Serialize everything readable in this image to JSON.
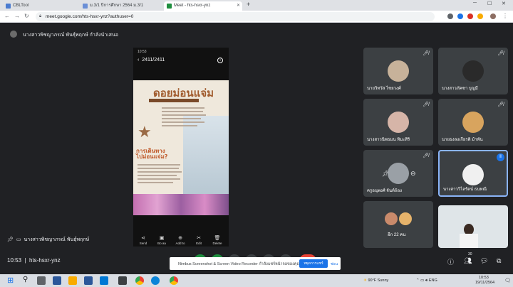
{
  "browser": {
    "tabs": [
      {
        "label": "CBLTool",
        "color": "#4a7bd0"
      },
      {
        "label": "ม.3/1 ปีการศึกษา 2564 ม.3/1",
        "color": "#6b8fd6"
      },
      {
        "label": "Meet - hts-hsxr-ynz",
        "color": "#1e8e3e",
        "close": "✕"
      }
    ],
    "new_tab": "+",
    "window_controls": {
      "minimize": "─",
      "maximize": "☐",
      "close": "✕"
    },
    "url": "meet.google.com/hts-hsxr-ynz?authuser=0"
  },
  "presenter": {
    "banner": "นางสาวพิชญาภรณ์ พันธุ์พฤกษ์ กำลังนำเสนอ",
    "bottom_label": "นางสาวพิชญาภรณ์ พันธุ์พฤกษ์"
  },
  "shared_screen": {
    "status_time": "10:53",
    "header": "2411/2411",
    "poster_title": "ดอยม่อนแจ่ม",
    "poster_subtitle_1": "การเดินทาง",
    "poster_subtitle_2": "ไปม่อนแจ่ม?",
    "actions": [
      "Send",
      "Bo aa",
      "Add to",
      "Edit",
      "Delete"
    ]
  },
  "participants": [
    {
      "name": "นายวิทวัส ไชยวงศ์",
      "muted": true,
      "avatar_color": "#c7b29a"
    },
    {
      "name": "นางสาวภัคชา บุญมี",
      "muted": true,
      "avatar_color": "#2a2a2a"
    },
    {
      "name": "นางสาวนิพธมน หิมะสิริ",
      "muted": true,
      "avatar_color": "#d6b5a8"
    },
    {
      "name": "นายธงลงเกียรติ ม้าพัน",
      "muted": true,
      "avatar_color": "#d8a45e"
    },
    {
      "name": "ครูอนุพงศ์ จันท์ถ้อง",
      "muted": true,
      "avatar_color": "#9aa0a6"
    },
    {
      "name": "นางสาววิไลรัตน์ ธนทณี",
      "muted": false,
      "avatar_color": "#f0f0f0"
    },
    {
      "name": "อีก 22 คน",
      "muted": false,
      "avatar_color": "#e6b36b"
    },
    {
      "name": "",
      "muted": false,
      "avatar_color": "#dfe5e8"
    }
  ],
  "meeting": {
    "time": "10:53",
    "code": "hts-hsxr-ynz",
    "participant_count": "30"
  },
  "notification": {
    "message": "Nimbus Screenshot & Screen Video Recorder กำลังแชร์หน้าจอของคุณ",
    "share_button": "หยุดการแชร์",
    "hide_button": "ซ่อน"
  },
  "taskbar": {
    "weather": "90°F  Sunny",
    "time": "10:53",
    "date": "19/11/2564"
  }
}
